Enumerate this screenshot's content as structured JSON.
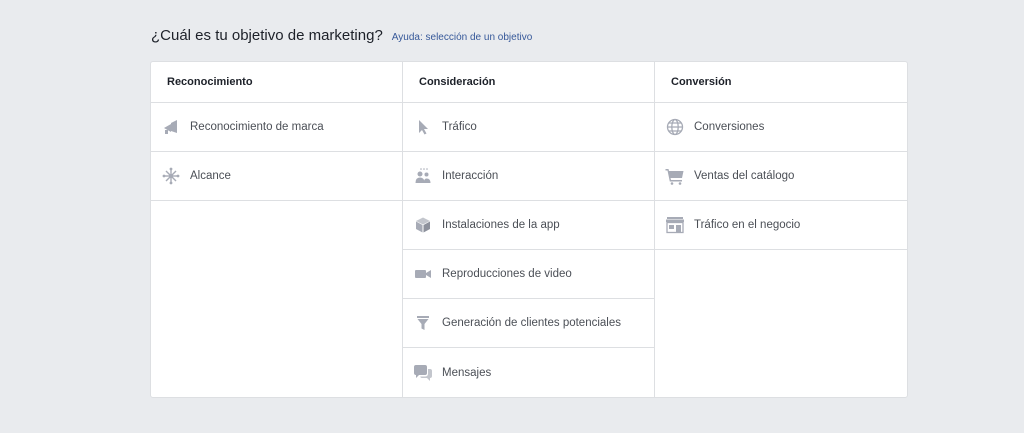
{
  "header": {
    "title": "¿Cuál es tu objetivo de marketing?",
    "help_link": "Ayuda: selección de un objetivo"
  },
  "colors": {
    "icon": "#a7abb6",
    "link": "#365899",
    "border": "#dddfe2",
    "page_bg": "#e9ebee"
  },
  "columns": [
    {
      "heading": "Reconocimiento",
      "items": [
        {
          "label": "Reconocimiento de marca",
          "icon": "megaphone-icon"
        },
        {
          "label": "Alcance",
          "icon": "reach-icon"
        }
      ]
    },
    {
      "heading": "Consideración",
      "items": [
        {
          "label": "Tráfico",
          "icon": "cursor-icon"
        },
        {
          "label": "Interacción",
          "icon": "people-icon"
        },
        {
          "label": "Instalaciones de la app",
          "icon": "box-icon"
        },
        {
          "label": "Reproducciones de video",
          "icon": "video-camera-icon"
        },
        {
          "label": "Generación de clientes potenciales",
          "icon": "funnel-icon"
        },
        {
          "label": "Mensajes",
          "icon": "chat-bubbles-icon"
        }
      ]
    },
    {
      "heading": "Conversión",
      "items": [
        {
          "label": "Conversiones",
          "icon": "globe-icon"
        },
        {
          "label": "Ventas del catálogo",
          "icon": "cart-icon"
        },
        {
          "label": "Tráfico en el negocio",
          "icon": "store-icon"
        }
      ]
    }
  ]
}
